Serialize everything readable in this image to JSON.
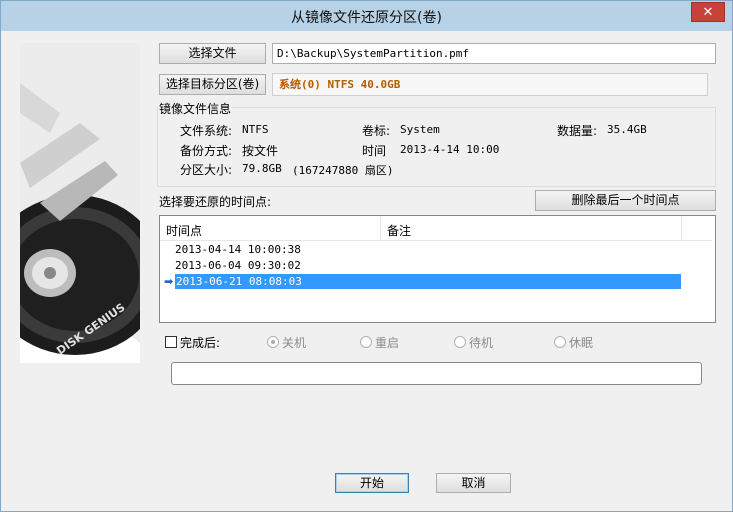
{
  "window": {
    "title": "从镜像文件还原分区(卷)",
    "close_glyph": "✕"
  },
  "art": {
    "brand_text": "DISK GENIUS"
  },
  "source": {
    "button_label": "选择文件",
    "path_value": "D:\\Backup\\SystemPartition.pmf"
  },
  "target": {
    "button_label": "选择目标分区(卷)",
    "value": "系统(0) NTFS 40.0GB"
  },
  "image_info": {
    "group_label": "镜像文件信息",
    "filesystem_label": "文件系统:",
    "filesystem_value": "NTFS",
    "volume_label": "卷标:",
    "volume_value": "System",
    "data_size_label": "数据量:",
    "data_size_value": "35.4GB",
    "backup_mode_label": "备份方式:",
    "backup_mode_value": "按文件",
    "time_label": "时间",
    "time_value": "2013-4-14 10:00",
    "partition_size_label": "分区大小:",
    "partition_size_value": "79.8GB",
    "sectors_value": "(167247880 扇区)"
  },
  "restore_points": {
    "label": "选择要还原的时间点:",
    "delete_button_label": "删除最后一个时间点",
    "columns": [
      "时间点",
      "备注"
    ],
    "rows": [
      "2013-04-14 10:00:38",
      "2013-06-04 09:30:02",
      "2013-06-21 08:08:03"
    ],
    "selected_index": 2,
    "selected_icon": "arrow-right-icon"
  },
  "after_complete": {
    "checkbox_label": "完成后:",
    "options": [
      "关机",
      "重启",
      "待机",
      "休眠"
    ],
    "selected_option": "关机",
    "progress_fraction": 0
  },
  "actions": {
    "start_label": "开始",
    "cancel_label": "取消"
  },
  "colors": {
    "titlebar": "#b7d2e6",
    "selection": "#3399ff",
    "target_text": "#b35d00",
    "close_button": "#c7433a"
  }
}
